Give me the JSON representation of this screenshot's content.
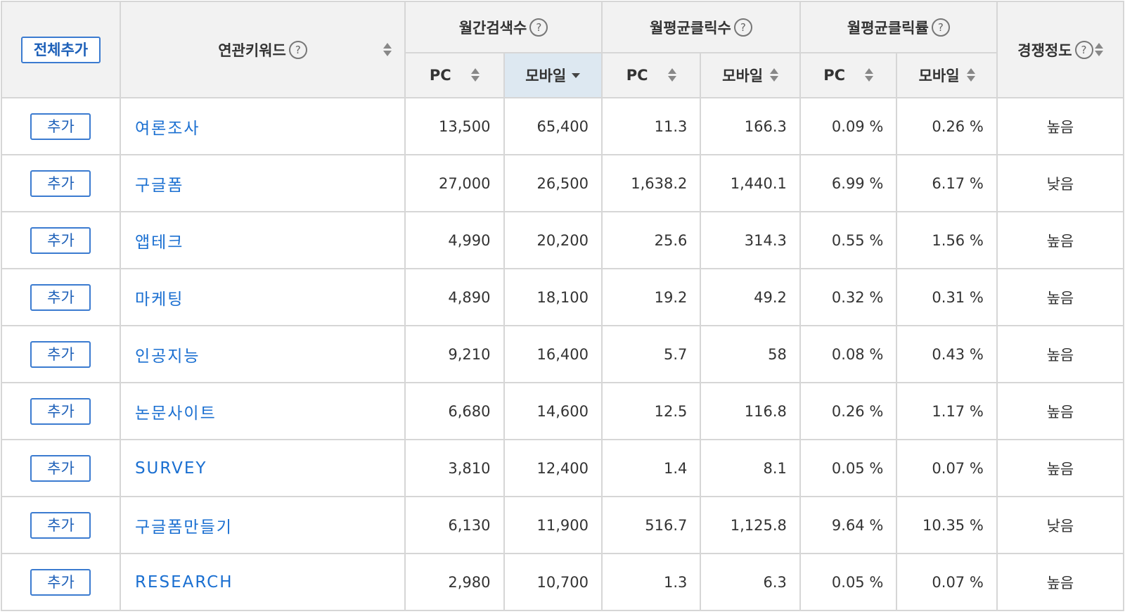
{
  "header": {
    "add_all_label": "전체추가",
    "keyword_label": "연관키워드",
    "monthly_search_label": "월간검색수",
    "avg_clicks_label": "월평균클릭수",
    "avg_ctr_label": "월평균클릭률",
    "competition_label": "경쟁정도",
    "pc_label": "PC",
    "mobile_label": "모바일",
    "help_glyph": "?"
  },
  "row_add_label": "추가",
  "rows": [
    {
      "keyword": "여론조사",
      "search_pc": "13,500",
      "search_mobile": "65,400",
      "click_pc": "11.3",
      "click_mobile": "166.3",
      "ctr_pc": "0.09 %",
      "ctr_mobile": "0.26 %",
      "competition": "높음"
    },
    {
      "keyword": "구글폼",
      "search_pc": "27,000",
      "search_mobile": "26,500",
      "click_pc": "1,638.2",
      "click_mobile": "1,440.1",
      "ctr_pc": "6.99 %",
      "ctr_mobile": "6.17 %",
      "competition": "낮음"
    },
    {
      "keyword": "앱테크",
      "search_pc": "4,990",
      "search_mobile": "20,200",
      "click_pc": "25.6",
      "click_mobile": "314.3",
      "ctr_pc": "0.55 %",
      "ctr_mobile": "1.56 %",
      "competition": "높음"
    },
    {
      "keyword": "마케팅",
      "search_pc": "4,890",
      "search_mobile": "18,100",
      "click_pc": "19.2",
      "click_mobile": "49.2",
      "ctr_pc": "0.32 %",
      "ctr_mobile": "0.31 %",
      "competition": "높음"
    },
    {
      "keyword": "인공지능",
      "search_pc": "9,210",
      "search_mobile": "16,400",
      "click_pc": "5.7",
      "click_mobile": "58",
      "ctr_pc": "0.08 %",
      "ctr_mobile": "0.43 %",
      "competition": "높음"
    },
    {
      "keyword": "논문사이트",
      "search_pc": "6,680",
      "search_mobile": "14,600",
      "click_pc": "12.5",
      "click_mobile": "116.8",
      "ctr_pc": "0.26 %",
      "ctr_mobile": "1.17 %",
      "competition": "높음"
    },
    {
      "keyword": "SURVEY",
      "search_pc": "3,810",
      "search_mobile": "12,400",
      "click_pc": "1.4",
      "click_mobile": "8.1",
      "ctr_pc": "0.05 %",
      "ctr_mobile": "0.07 %",
      "competition": "높음"
    },
    {
      "keyword": "구글폼만들기",
      "search_pc": "6,130",
      "search_mobile": "11,900",
      "click_pc": "516.7",
      "click_mobile": "1,125.8",
      "ctr_pc": "9.64 %",
      "ctr_mobile": "10.35 %",
      "competition": "낮음"
    },
    {
      "keyword": "RESEARCH",
      "search_pc": "2,980",
      "search_mobile": "10,700",
      "click_pc": "1.3",
      "click_mobile": "6.3",
      "ctr_pc": "0.05 %",
      "ctr_mobile": "0.07 %",
      "competition": "높음"
    }
  ]
}
